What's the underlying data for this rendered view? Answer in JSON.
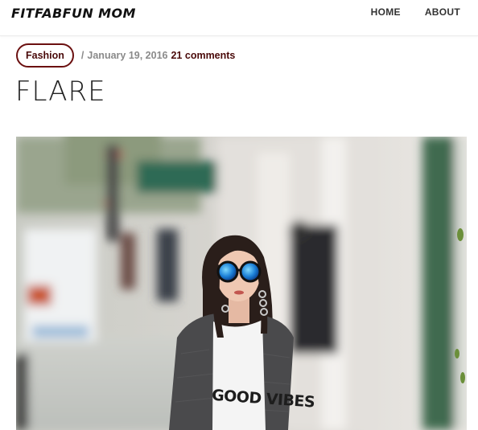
{
  "site": {
    "logo": "FITFABFUN MOM"
  },
  "nav": {
    "items": [
      {
        "label": "HOME"
      },
      {
        "label": "ABOUT"
      }
    ]
  },
  "post": {
    "category": "Fashion",
    "separator": "/",
    "date": "January 19, 2016",
    "comments": "21 comments",
    "title": "FLARE",
    "image": {
      "shirt_text": "GOOD VIBES"
    }
  },
  "colors": {
    "accent": "#6b1010",
    "muted": "#8a8a8a"
  }
}
